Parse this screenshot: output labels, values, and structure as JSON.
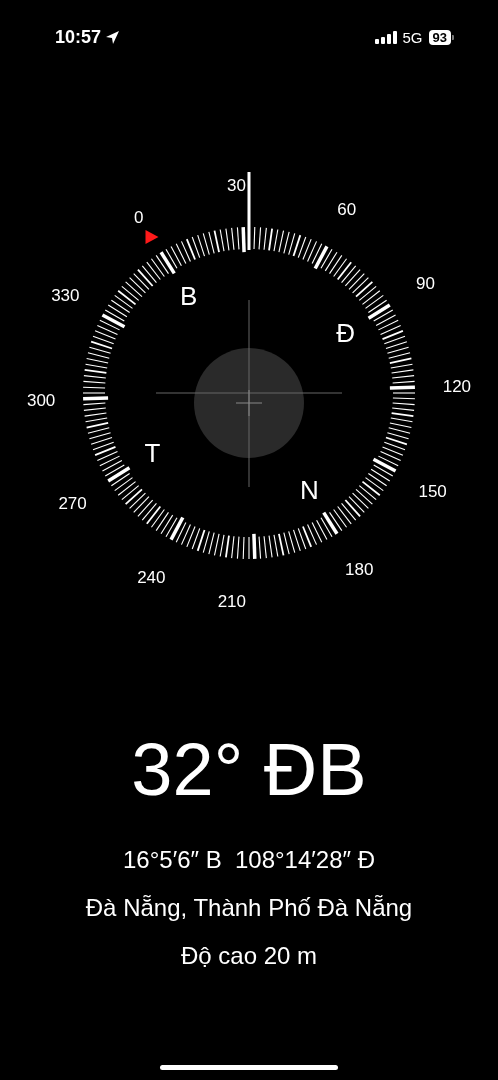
{
  "status_bar": {
    "time": "10:57",
    "network": "5G",
    "battery": "93"
  },
  "compass": {
    "degree_labels": [
      "0",
      "30",
      "60",
      "90",
      "120",
      "150",
      "180",
      "210",
      "240",
      "270",
      "300",
      "330"
    ],
    "cardinals": [
      "B",
      "Đ",
      "N",
      "T"
    ]
  },
  "heading": "32° ĐB",
  "coordinates": "16°5′6″ B  108°14′28″ Đ",
  "location": "Đà Nẵng, Thành Phố Đà Nẵng",
  "altitude": "Độ cao 20 m"
}
